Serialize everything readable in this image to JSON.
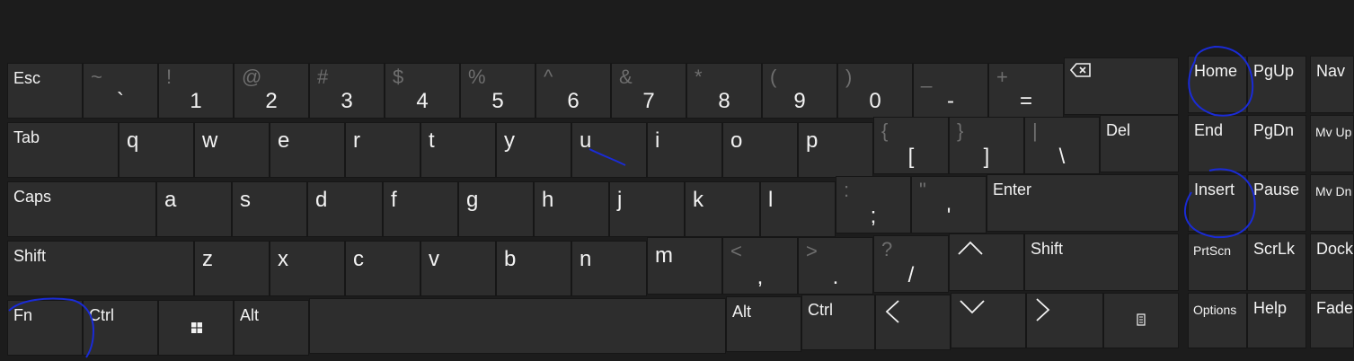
{
  "keyboard": {
    "row1": [
      {
        "label": "Esc"
      },
      {
        "shift": "~",
        "main": "`"
      },
      {
        "shift": "!",
        "main": "1"
      },
      {
        "shift": "@",
        "main": "2"
      },
      {
        "shift": "#",
        "main": "3"
      },
      {
        "shift": "$",
        "main": "4"
      },
      {
        "shift": "%",
        "main": "5"
      },
      {
        "shift": "^",
        "main": "6"
      },
      {
        "shift": "&",
        "main": "7"
      },
      {
        "shift": "*",
        "main": "8"
      },
      {
        "shift": "(",
        "main": "9"
      },
      {
        "shift": ")",
        "main": "0"
      },
      {
        "shift": "_",
        "main": "-"
      },
      {
        "shift": "+",
        "main": "="
      }
    ],
    "row2": [
      {
        "label": "Tab"
      },
      {
        "main": "q"
      },
      {
        "main": "w"
      },
      {
        "main": "e"
      },
      {
        "main": "r"
      },
      {
        "main": "t"
      },
      {
        "main": "y"
      },
      {
        "main": "u"
      },
      {
        "main": "i"
      },
      {
        "main": "o"
      },
      {
        "main": "p"
      },
      {
        "shift": "{",
        "main": "["
      },
      {
        "shift": "}",
        "main": "]"
      },
      {
        "shift": "|",
        "main": "\\"
      },
      {
        "label": "Del"
      }
    ],
    "row3": [
      {
        "label": "Caps"
      },
      {
        "main": "a"
      },
      {
        "main": "s"
      },
      {
        "main": "d"
      },
      {
        "main": "f"
      },
      {
        "main": "g"
      },
      {
        "main": "h"
      },
      {
        "main": "j"
      },
      {
        "main": "k"
      },
      {
        "main": "l"
      },
      {
        "shift": ":",
        "main": ";"
      },
      {
        "shift": "\"",
        "main": "'"
      },
      {
        "label": "Enter"
      }
    ],
    "row4": [
      {
        "label": "Shift"
      },
      {
        "main": "z"
      },
      {
        "main": "x"
      },
      {
        "main": "c"
      },
      {
        "main": "v"
      },
      {
        "main": "b"
      },
      {
        "main": "n"
      },
      {
        "main": "m"
      },
      {
        "shift": "<",
        "main": ","
      },
      {
        "shift": ">",
        "main": "."
      },
      {
        "shift": "?",
        "main": "/"
      },
      {
        "label": "Shift"
      }
    ],
    "row5": {
      "fn": "Fn",
      "ctrl_left": "Ctrl",
      "alt_left": "Alt",
      "alt_right": "Alt",
      "ctrl_right": "Ctrl"
    },
    "nav": {
      "row1": [
        "Home",
        "PgUp",
        "Nav"
      ],
      "row2": [
        "End",
        "PgDn",
        "Mv Up"
      ],
      "row3": [
        "Insert",
        "Pause",
        "Mv Dn"
      ],
      "row4": [
        "PrtScn",
        "ScrLk",
        "Dock"
      ],
      "row5": [
        "Options",
        "Help",
        "Fade"
      ]
    },
    "icons": {
      "backspace": "backspace-icon",
      "windows": "windows-logo-icon",
      "menu": "context-menu-icon"
    },
    "colors": {
      "background": "#1c1c1c",
      "key": "#2d2d2d",
      "ink": "#1a2bd6"
    }
  }
}
